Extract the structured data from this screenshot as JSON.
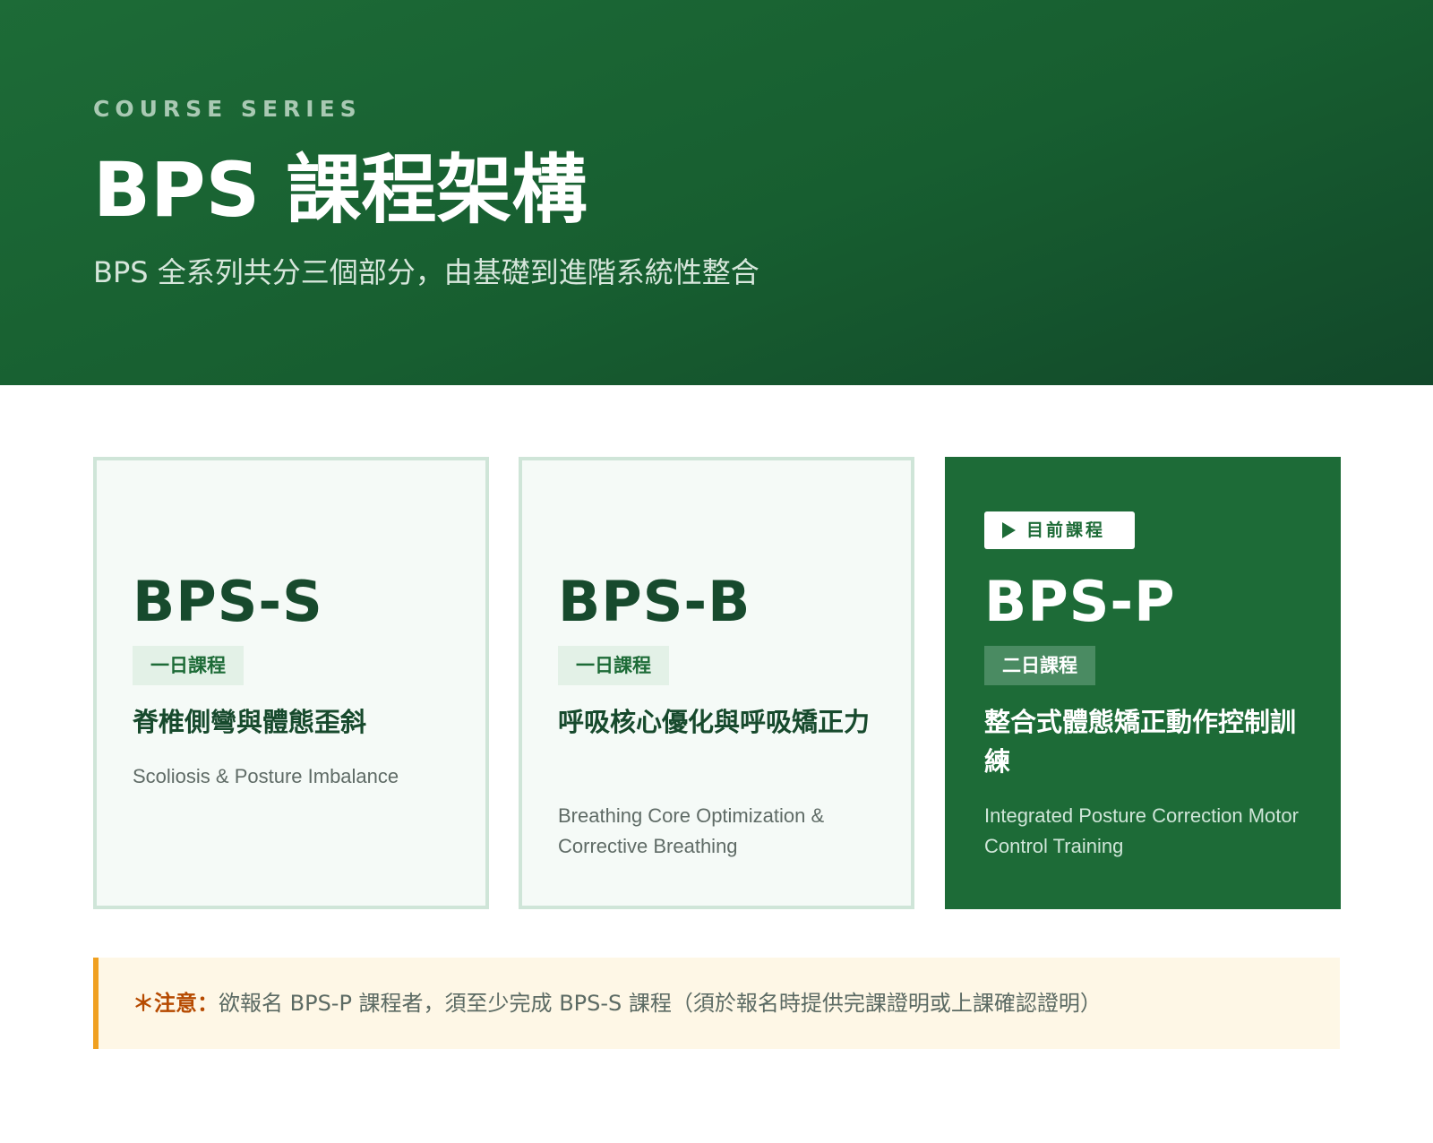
{
  "hero": {
    "eyebrow": "COURSE SERIES",
    "title": "BPS 課程架構",
    "subtitle": "BPS 全系列共分三個部分，由基礎到進階系統性整合"
  },
  "courses": [
    {
      "code": "BPS-S",
      "duration": "一日課程",
      "title_zh": "脊椎側彎與體態歪斜",
      "title_en": "Scoliosis & Posture Imbalance"
    },
    {
      "code": "BPS-B",
      "duration": "一日課程",
      "title_zh": "呼吸核心優化與呼吸矯正力",
      "title_en": "Breathing Core Optimization & Corrective Breathing"
    },
    {
      "code": "BPS-P",
      "badge": "目前課程",
      "badge_icon": "play-icon",
      "duration": "二日課程",
      "title_zh": "整合式體態矯正動作控制訓練",
      "title_en": "Integrated Posture Correction Motor Control Training"
    }
  ],
  "note": {
    "prefix": "＊注意：",
    "text": "欲報名 BPS-P 課程者，須至少完成 BPS-S 課程（須於報名時提供完課證明或上課確認證明）"
  },
  "colors": {
    "brand_green": "#1d6b37",
    "dark_green_text": "#174a2d",
    "note_accent": "#f0a020",
    "note_background": "#fef7e6"
  }
}
